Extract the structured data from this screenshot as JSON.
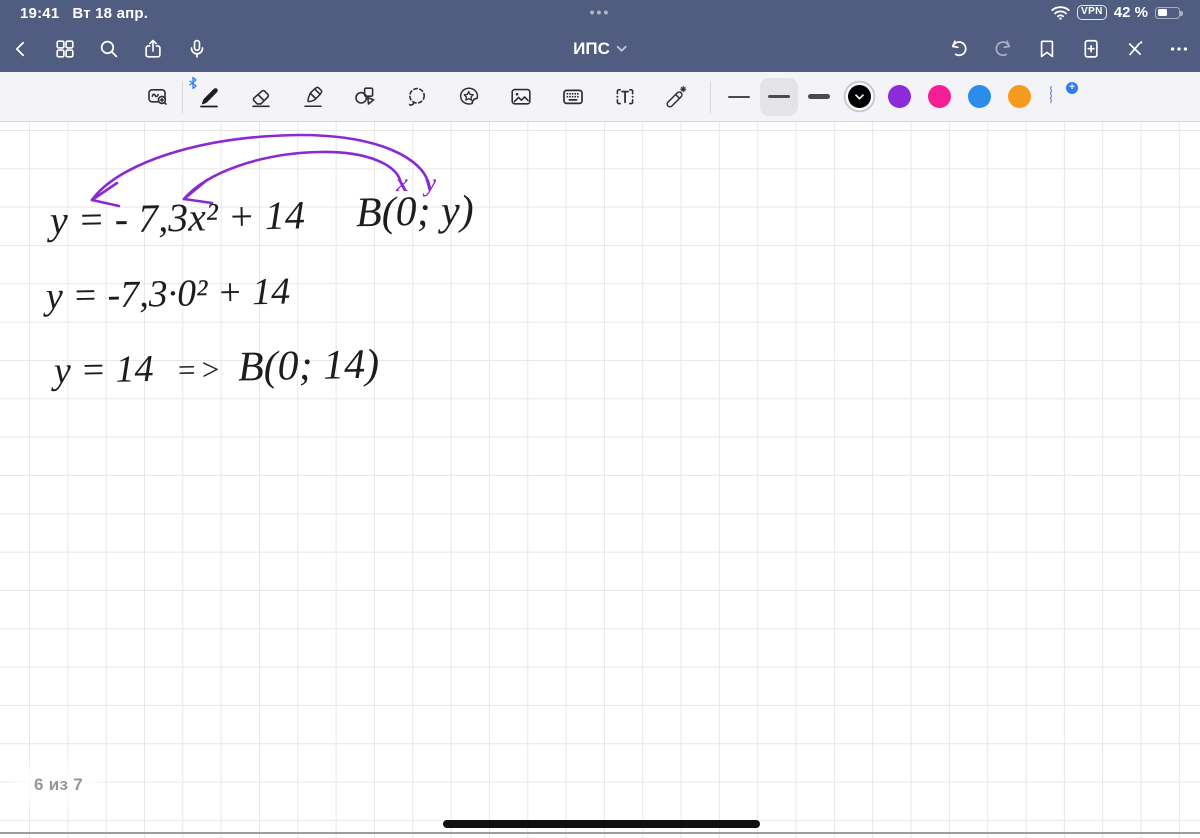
{
  "status_bar": {
    "time": "19:41",
    "date": "Вт 18 апр.",
    "multitask_dots": "•••",
    "vpn_label": "VPN",
    "battery_text": "42 %",
    "battery_percent": 42
  },
  "navbar": {
    "title": "ИПС",
    "background_color": "#515d80",
    "icons_left": [
      "back",
      "pages-grid",
      "search",
      "share",
      "microphone"
    ],
    "icons_right": [
      "undo",
      "redo",
      "bookmark",
      "add-page",
      "edit-mode-toggle",
      "more"
    ]
  },
  "toolbar": {
    "tools": [
      "zoom-window",
      "pen",
      "eraser",
      "highlighter",
      "shapes",
      "lasso",
      "stickers",
      "image",
      "keyboard",
      "text",
      "laser-pointer"
    ],
    "selected_tool": "pen",
    "thickness_options": [
      "thin",
      "medium",
      "thick"
    ],
    "selected_thickness": "medium",
    "colors": {
      "selected": "black",
      "swatches": [
        {
          "name": "black",
          "hex": "#000000",
          "selected": true
        },
        {
          "name": "purple",
          "hex": "#8b2bd9"
        },
        {
          "name": "pink",
          "hex": "#f41e95"
        },
        {
          "name": "blue",
          "hex": "#2c8cea"
        },
        {
          "name": "orange",
          "hex": "#f49a1e"
        }
      ],
      "add_color_label": "+"
    }
  },
  "canvas": {
    "handwriting": {
      "ink_color": "#1d1d1f",
      "annotation_color": "#8a2ad2",
      "line1": "y = - 7,3x² + 14",
      "point_b": "B(0; y)",
      "label_x": "x",
      "label_y": "y",
      "line2": "y = -7,3·0² + 14",
      "line3_left": "y = 14",
      "line3_arrow": "=>",
      "line3_right": "B(0; 14)"
    },
    "page_indicator": "6 из 7"
  }
}
